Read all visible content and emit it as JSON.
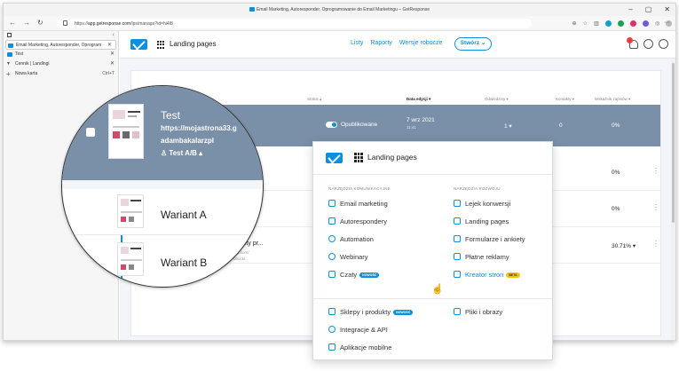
{
  "browser": {
    "title": "Email Marketing, Autoresponder, Oprogramowanie do Email Marketingu – GetResponse",
    "url_prefix": "https://",
    "url_domain": "app.getresponse.com",
    "url_path": "/lps/manage?id=hi4I8",
    "win_min": "–",
    "win_max": "▢",
    "win_close": "✕",
    "more": "···"
  },
  "sidebar": {
    "collapse": "‹",
    "tabs": [
      {
        "label": "Email Marketing, Autoresponder, Oprogram",
        "close": "✕"
      },
      {
        "label": "Test",
        "close": "✕"
      },
      {
        "label": "Cennik | Landingi",
        "close": "✕"
      }
    ],
    "new_tab": {
      "label": "Nowa karta",
      "shortcut": "Ctrl+T"
    }
  },
  "app": {
    "title": "Landing pages",
    "menu": [
      "Listy",
      "Raporty",
      "Wersje robocze"
    ],
    "create": "Stwórz ⌄"
  },
  "table": {
    "headers": {
      "status": "Status ▴",
      "date": "Data edycji ▾",
      "visits": "Odwiedziny ▾",
      "contacts": "Kontakty ▾",
      "rate": "Wskaźnik zapisów ▾"
    },
    "row1": {
      "status": "Opublikowane",
      "date": "7 wrz 2021",
      "time": "11:41",
      "visits": "1 ▾",
      "contacts": "0",
      "rate": "0%"
    },
    "rows": [
      {
        "rate": "0%",
        "kebab": "⋮"
      },
      {
        "rate": "0%",
        "kebab": "⋮"
      },
      {
        "name": "kosztу pr...",
        "url": "gr8.com/",
        "author": "obocki",
        "rate": "30.71% ▾",
        "kebab": "⋮"
      }
    ]
  },
  "lens": {
    "title": "Test",
    "url": "https://mojastrona33.g",
    "author": "adambakalarzpl",
    "ab": "♙ Test A/B ▴",
    "variant_a": "Wariant A",
    "variant_b": "Wariant B"
  },
  "panel": {
    "title": "Landing pages",
    "section_left": "NARZĘDZIA KOMUNIKACYJNE",
    "section_right": "NARZĘDZIA ROZWOJU",
    "left_items": [
      "Email marketing",
      "Autorespondery",
      "Automation",
      "Webinary",
      "Czaty"
    ],
    "right_items": [
      "Lejek konwersji",
      "Landing pages",
      "Formularze i ankiety",
      "Płatne reklamy",
      "Kreator stron"
    ],
    "badge_new": "NOWOŚĆ",
    "badge_beta": "BETA",
    "bottom_left": [
      "Sklepy i produkty",
      "Integracje & API",
      "Aplikacje mobilne"
    ],
    "bottom_right": [
      "Pliki i obrazy"
    ]
  },
  "colors": {
    "accent": "#0b8fe0",
    "row_highlight": "#7a8fa8",
    "beta": "#f5c400"
  }
}
